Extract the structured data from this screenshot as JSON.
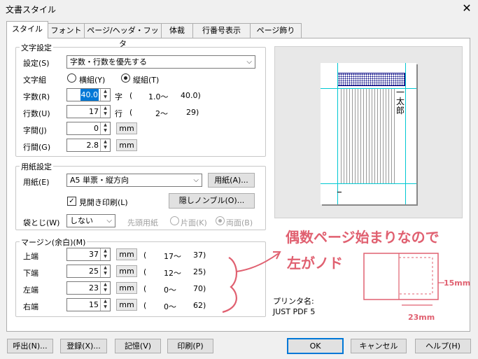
{
  "window": {
    "title": "文書スタイル",
    "close_glyph": "✕"
  },
  "tabs": [
    "スタイル",
    "フォント",
    "ページ/ヘッダ・フッタ",
    "体裁",
    "行番号表示",
    "ページ飾り"
  ],
  "moji": {
    "group_label": "文字設定",
    "settei_label": "設定(S)",
    "settei_value": "字数・行数を優先する",
    "mojigumi_label": "文字組",
    "yoko_label": "横組(Y)",
    "tate_label": "縦組(T)",
    "jisu_label": "字数(R)",
    "jisu_value": "40.0",
    "jisu_unit": "字",
    "jisu_range_open": "(",
    "jisu_range": "1.0〜",
    "jisu_max": "40.0)",
    "gyosu_label": "行数(U)",
    "gyosu_value": "17",
    "gyosu_unit": "行",
    "gyosu_range_open": "(",
    "gyosu_range": "2〜",
    "gyosu_max": "29)",
    "jikan_label": "字間(J)",
    "jikan_value": "0",
    "gyokan_label": "行間(G)",
    "gyokan_value": "2.8",
    "mm": "mm"
  },
  "yoshi": {
    "group_label": "用紙設定",
    "yoshi_label": "用紙(E)",
    "yoshi_value": "A5 単票・縦方向",
    "yoshi_button": "用紙(A)...",
    "mihiraki_label": "見開き印刷(L)",
    "nombre_button": "隠しノンブル(O)...",
    "fukuro_label": "袋とじ(W)",
    "fukuro_value": "しない",
    "sento_label": "先頭用紙",
    "katamen_label": "片面(K)",
    "ryomen_label": "両面(B)"
  },
  "margin": {
    "group_label": "マージン(余白)(M)",
    "rows": [
      {
        "label": "上端",
        "value": "37",
        "unit": "mm",
        "open": "(",
        "min": "17〜",
        "max": "37)"
      },
      {
        "label": "下端",
        "value": "25",
        "unit": "mm",
        "open": "(",
        "min": "12〜",
        "max": "25)"
      },
      {
        "label": "左端",
        "value": "23",
        "unit": "mm",
        "open": "(",
        "min": "0〜",
        "max": "70)"
      },
      {
        "label": "右端",
        "value": "15",
        "unit": "mm",
        "open": "(",
        "min": "0〜",
        "max": "62)"
      }
    ]
  },
  "preview": {
    "title_chars": "一太郎"
  },
  "printer": {
    "label": "プリンタ名:",
    "name": "JUST PDF 5"
  },
  "annotation": {
    "line1": "偶数ページ始まりなので",
    "line2": "左がノド",
    "dim_right": "15mm",
    "dim_bottom": "23mm"
  },
  "footer": {
    "yobidashi": "呼出(N)...",
    "toroku": "登録(X)...",
    "kioku": "記憶(V)",
    "insatsu": "印刷(P)",
    "ok": "OK",
    "cancel": "キャンセル",
    "help": "ヘルプ(H)"
  }
}
